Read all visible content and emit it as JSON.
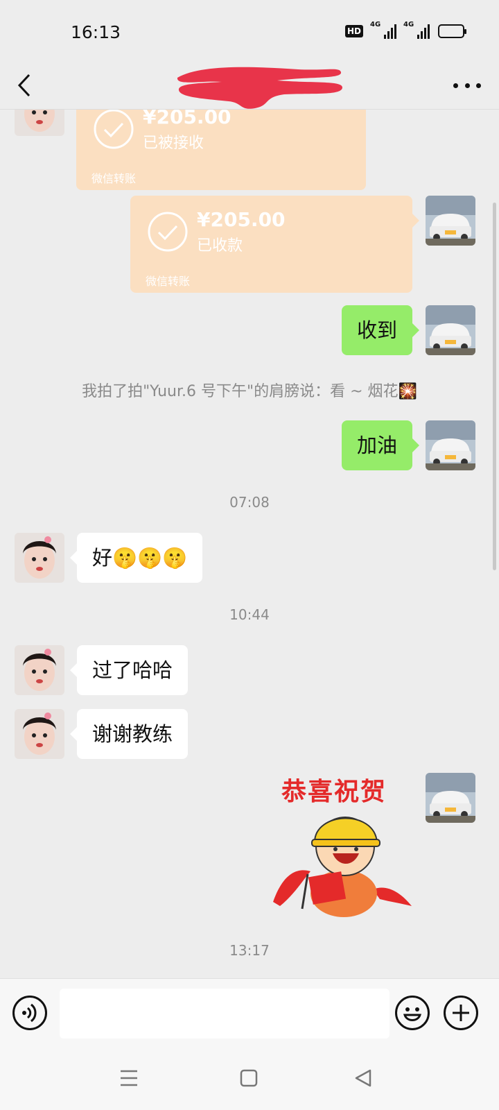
{
  "status_bar": {
    "time": "16:13",
    "hd_label": "HD",
    "net1": "4G",
    "net2": "4G",
    "battery_level": 0.3
  },
  "header": {
    "title": ""
  },
  "messages": {
    "transfer_1": {
      "amount": "¥205.00",
      "state": "已被接收",
      "footer": "微信转账"
    },
    "transfer_2": {
      "amount": "¥205.00",
      "state": "已收款",
      "footer": "微信转账"
    },
    "msg_received": "收到",
    "pat_notice": "我拍了拍\"Yuur.6 号下午\"的肩膀说：看 ~ 烟花🎇",
    "msg_jiayou": "加油",
    "time_1": "07:08",
    "msg_hao": "好🤫🤫🤫",
    "time_2": "10:44",
    "msg_guole": "过了哈哈",
    "msg_thanks": "谢谢教练",
    "sticker_text": "恭喜祝贺",
    "time_3": "13:17"
  },
  "input": {
    "value": "",
    "placeholder": ""
  },
  "icons": {
    "back": "back-arrow-icon",
    "more": "more-dots-icon",
    "voice": "voice-icon",
    "emoji": "emoji-icon",
    "plus": "plus-icon",
    "nav_menu": "menu-icon",
    "nav_home": "home-icon",
    "nav_back": "back-triangle-icon"
  },
  "colors": {
    "sent_bubble": "#95ec69",
    "received_bubble": "#ffffff",
    "transfer_card": "#fbdfc1",
    "background": "#ededed"
  }
}
